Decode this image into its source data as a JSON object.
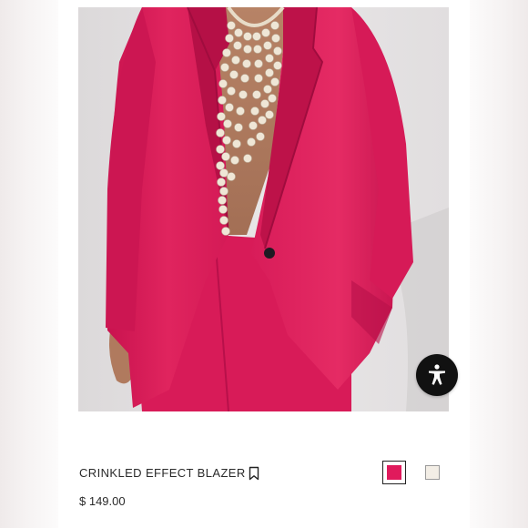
{
  "product": {
    "name": "CRINKLED EFFECT BLAZER",
    "price": "$ 149.00",
    "image": {
      "subject": "model-in-pink-blazer",
      "icon": "product-photo"
    }
  },
  "color_options": [
    {
      "color": "#e01a5c",
      "selected": true
    },
    {
      "color": "#f3eee6",
      "selected": false
    }
  ],
  "icons": {
    "bookmark": "bookmark-icon",
    "accessibility": "accessibility-icon"
  },
  "colors": {
    "blazer": "#e0245e",
    "background": "#ffffff",
    "text": "#2a2a2a",
    "accessibility_button": "#111111"
  }
}
